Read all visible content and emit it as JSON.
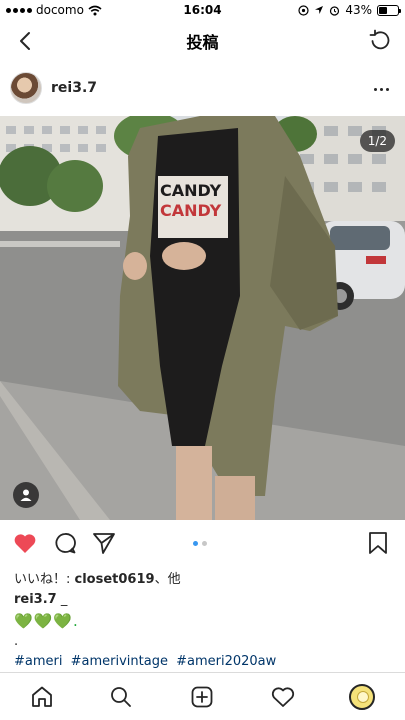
{
  "status_bar": {
    "carrier": "docomo",
    "time": "16:04",
    "battery_percent": "43%",
    "battery_level": 0.43
  },
  "nav": {
    "title": "投稿",
    "back_icon": "chevron-left-icon",
    "refresh_icon": "refresh-icon"
  },
  "post": {
    "username": "rei3.7",
    "image_counter": "1/2",
    "image_page_index": 0,
    "image_page_count": 2
  },
  "likes": {
    "prefix": "いいね！: ",
    "user": "closet0619",
    "suffix": "、他"
  },
  "caption": {
    "username": "rei3.7",
    "extra": " _",
    "hearts": "💚💚💚.",
    "dot_line": ".",
    "hashtags": [
      "#ameri",
      "#amerivintage",
      "#ameri2020aw"
    ]
  },
  "colors": {
    "like_red": "#ed4956",
    "heart_green": "#22a83a",
    "link_blue": "#003569",
    "dot_active": "#3897f0"
  }
}
